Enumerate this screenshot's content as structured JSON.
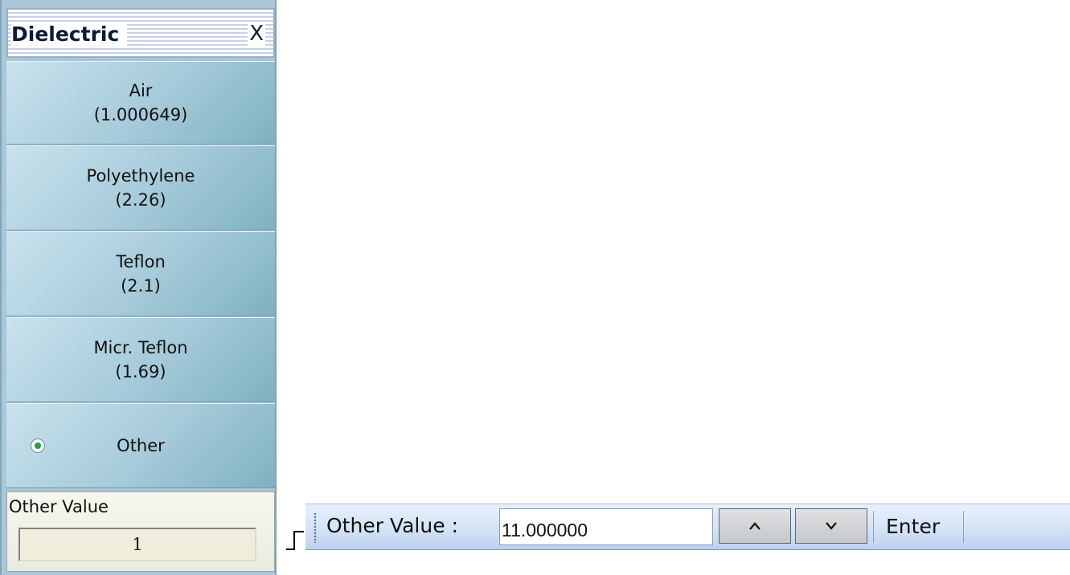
{
  "panel": {
    "title": "Dielectric",
    "close_label": "X",
    "options": [
      {
        "name": "Air",
        "value": "(1.000649)"
      },
      {
        "name": "Polyethylene",
        "value": "(2.26)"
      },
      {
        "name": "Teflon",
        "value": "(2.1)"
      },
      {
        "name": "Micr. Teflon",
        "value": "(1.69)"
      },
      {
        "name": "Other",
        "selected": true
      }
    ],
    "other_value": {
      "label": "Other Value",
      "value": "1"
    }
  },
  "toolbar": {
    "label": "Other Value  :",
    "input_value": "11.000000",
    "up_icon": "chevron-up-icon",
    "down_icon": "chevron-down-icon",
    "enter_label": "Enter"
  },
  "colors": {
    "panel_bg": "#a9c7d6",
    "button_gradient_light": "#c9e2ee",
    "button_gradient_dark": "#7fb1c1",
    "radio_selected": "#2e9a48",
    "toolbar_bg": "#d4e3f7"
  }
}
